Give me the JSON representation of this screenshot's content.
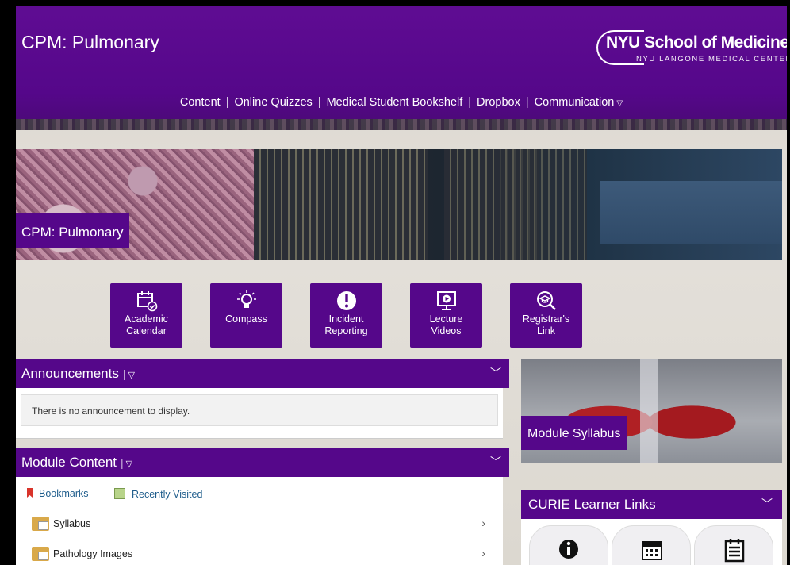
{
  "header": {
    "site_title": "CPM: Pulmonary",
    "logo_main": "NYU School of Medicine",
    "logo_sub": "NYU LANGONE MEDICAL CENTER",
    "nav": [
      {
        "label": "Content"
      },
      {
        "label": "Online Quizzes"
      },
      {
        "label": "Medical Student Bookshelf"
      },
      {
        "label": "Dropbox"
      },
      {
        "label": "Communication"
      }
    ]
  },
  "banner": {
    "caption": "CPM: Pulmonary"
  },
  "quick_links": [
    {
      "label_line1": "Academic",
      "label_line2": "Calendar",
      "icon": "calendar-check-icon"
    },
    {
      "label_line1": "Compass",
      "label_line2": "",
      "icon": "lightbulb-icon"
    },
    {
      "label_line1": "Incident",
      "label_line2": "Reporting",
      "icon": "alert-icon"
    },
    {
      "label_line1": "Lecture",
      "label_line2": "Videos",
      "icon": "video-play-icon"
    },
    {
      "label_line1": "Registrar's",
      "label_line2": "Link",
      "icon": "graduation-search-icon"
    }
  ],
  "announcements": {
    "title": "Announcements",
    "empty_text": "There is no announcement to display."
  },
  "module_content": {
    "title": "Module Content",
    "bookmarks": "Bookmarks",
    "recently_visited": "Recently Visited",
    "items": [
      {
        "label": "Syllabus"
      },
      {
        "label": "Pathology Images"
      }
    ]
  },
  "syllabus_widget": {
    "caption": "Module Syllabus"
  },
  "curie": {
    "title": "CURIE Learner Links",
    "tiles": [
      "info-icon",
      "calendar-icon",
      "checklist-icon"
    ]
  },
  "colors": {
    "brand_purple": "#55078a"
  }
}
